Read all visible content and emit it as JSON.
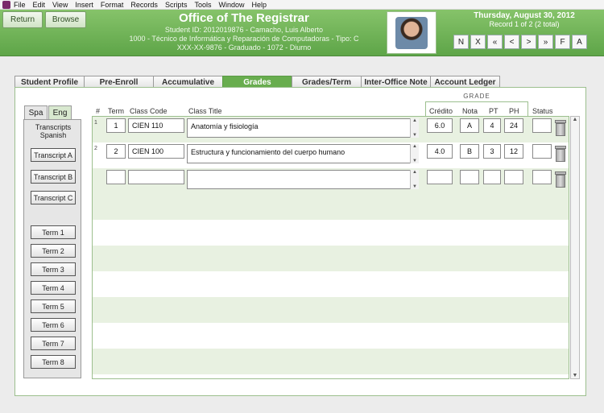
{
  "menu": [
    "File",
    "Edit",
    "View",
    "Insert",
    "Format",
    "Records",
    "Scripts",
    "Tools",
    "Window",
    "Help"
  ],
  "header": {
    "return_label": "Return",
    "browse_label": "Browse",
    "title": "Office of The Registrar",
    "student_line": "Student ID: 2012019876 - Camacho, Luis Alberto",
    "program_line": "1000 - Técnico de Informática y Reparación de Computadoras - Tipo: C",
    "status_line": "XXX-XX-9876 - Graduado - 1072 - Diurno",
    "date": "Thursday, August 30, 2012",
    "record": "Record 1 of 2 (2 total)",
    "nav_buttons": [
      "N",
      "X",
      "«",
      "<",
      ">",
      "»",
      "F",
      "A"
    ]
  },
  "tabs": [
    "Student Profile",
    "Pre-Enroll",
    "Accumulative",
    "Grades",
    "Grades/Term",
    "Inter-Office Note",
    "Account Ledger"
  ],
  "active_tab": "Grades",
  "left_panel": {
    "lang_tabs": [
      "Spa",
      "Eng"
    ],
    "label_line1": "Transcripts",
    "label_line2": "Spanish",
    "transcripts": [
      "Transcript A",
      "Transcript B",
      "Transcript C"
    ],
    "terms": [
      "Term 1",
      "Term 2",
      "Term 3",
      "Term 4",
      "Term 5",
      "Term 6",
      "Term 7",
      "Term 8"
    ]
  },
  "grid": {
    "grade_header": "GRADE",
    "columns": [
      "#",
      "Term",
      "Class Code",
      "Class Title",
      "Crédito",
      "Nota",
      "PT",
      "PH",
      "Status"
    ],
    "rows": [
      {
        "num": "1",
        "term": "1",
        "code": "CIEN 110",
        "title": "Anatomía y fisiología",
        "credito": "6.0",
        "nota": "A",
        "pt": "4",
        "ph": "24",
        "status": ""
      },
      {
        "num": "2",
        "term": "2",
        "code": "CIEN 100",
        "title": "Estructura y funcionamiento del cuerpo humano",
        "credito": "4.0",
        "nota": "B",
        "pt": "3",
        "ph": "12",
        "status": ""
      },
      {
        "num": "",
        "term": "",
        "code": "",
        "title": "",
        "credito": "",
        "nota": "",
        "pt": "",
        "ph": "",
        "status": ""
      }
    ]
  }
}
